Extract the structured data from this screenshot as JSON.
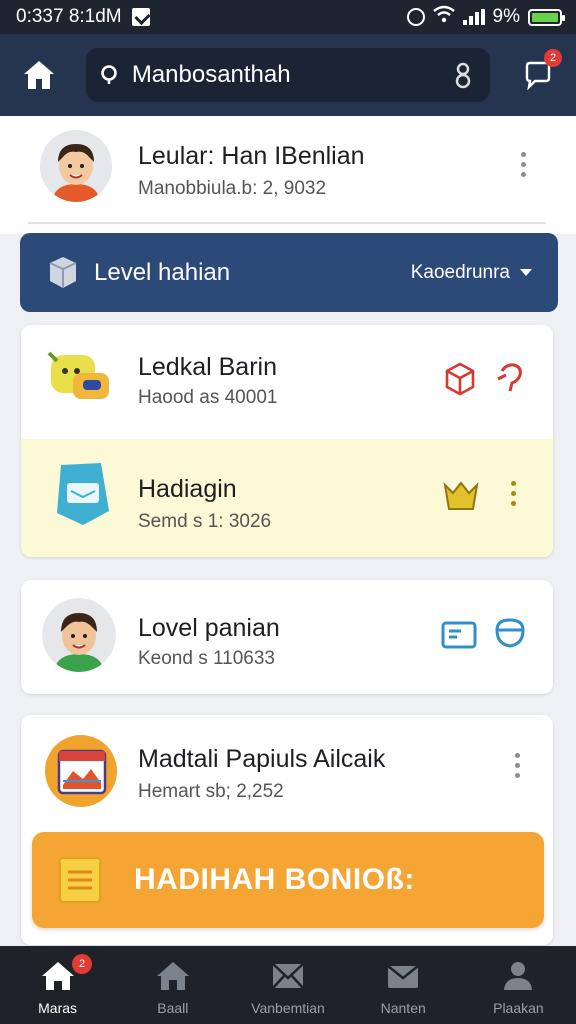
{
  "status_bar": {
    "time": "0:337 8:1dM",
    "battery": "9%"
  },
  "top_bar": {
    "search_text": "Manbosanthah",
    "chat_badge": "2"
  },
  "profile": {
    "name": "Leular: Han IBenlian",
    "sub": "Manobbiula.b: 2, 9032"
  },
  "level_banner": {
    "title": "Level hahian",
    "dropdown": "Kaoedrunra"
  },
  "list_items": [
    {
      "title": "Ledkal Barin",
      "sub": "Haood as 40001"
    },
    {
      "title": "Hadiagin",
      "sub": "Semd s 1: 3026"
    },
    {
      "title": "Lovel panian",
      "sub": "Keond s 110633"
    },
    {
      "title": "Madtali Papiuls Ailcaik",
      "sub": "Hemart sb; 2,252"
    }
  ],
  "bonus_button": {
    "label": "HADIHAH BONIOß:"
  },
  "bottom_nav": {
    "items": [
      {
        "label": "Maras",
        "icon": "home-icon",
        "badge": "2"
      },
      {
        "label": "Baall",
        "icon": "store-icon"
      },
      {
        "label": "Vanbemtian",
        "icon": "mail-open-icon"
      },
      {
        "label": "Nanten",
        "icon": "mail-icon"
      },
      {
        "label": "Plaakan",
        "icon": "person-icon"
      }
    ]
  },
  "colors": {
    "top_bar": "#26354f",
    "level_banner": "#2c4a78",
    "bonus": "#f4a533",
    "highlight": "#fbf9d6",
    "nav": "#1f2228"
  }
}
